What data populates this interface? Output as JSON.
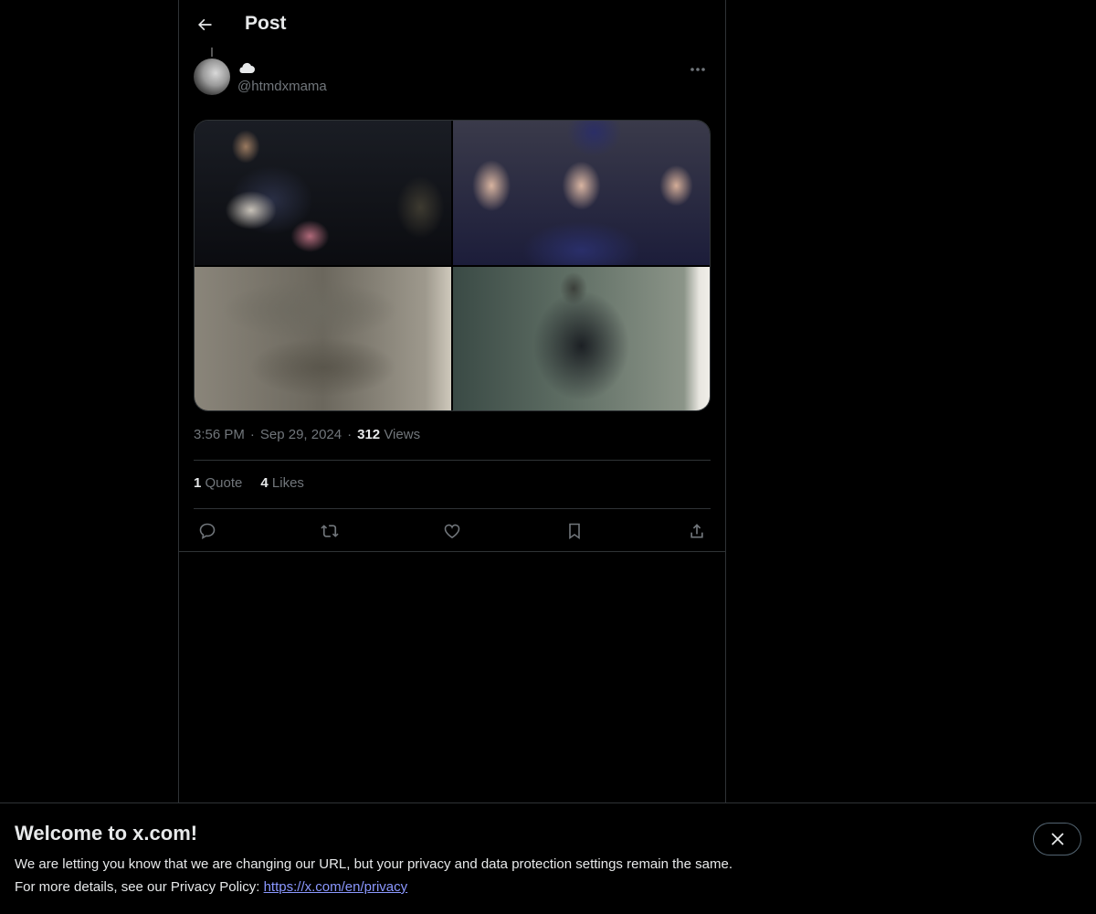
{
  "header": {
    "title": "Post",
    "back_icon": "arrow-left-icon"
  },
  "author": {
    "display_name_icon": "cloud-icon",
    "handle": "@htmdxmama",
    "more_icon": "ellipsis-icon"
  },
  "media": {
    "photo_count": 4
  },
  "meta": {
    "time": "3:56 PM",
    "separator": "·",
    "date": "Sep 29, 2024",
    "views_count": "312",
    "views_label": "Views"
  },
  "stats": {
    "quotes_count": "1",
    "quotes_label": "Quote",
    "likes_count": "4",
    "likes_label": "Likes"
  },
  "actions": [
    "reply-icon",
    "repost-icon",
    "like-icon",
    "bookmark-icon",
    "share-icon"
  ],
  "banner": {
    "title": "Welcome to x.com!",
    "line1": "We are letting you know that we are changing our URL, but your privacy and data protection settings remain the same.",
    "line2_prefix": "For more details, see our Privacy Policy: ",
    "link": "https://x.com/en/privacy",
    "close_icon": "close-icon"
  },
  "colors": {
    "background": "#000000",
    "text": "#e7e9ea",
    "muted": "#71767b",
    "border": "#2f3336",
    "link": "#8b98ff"
  }
}
